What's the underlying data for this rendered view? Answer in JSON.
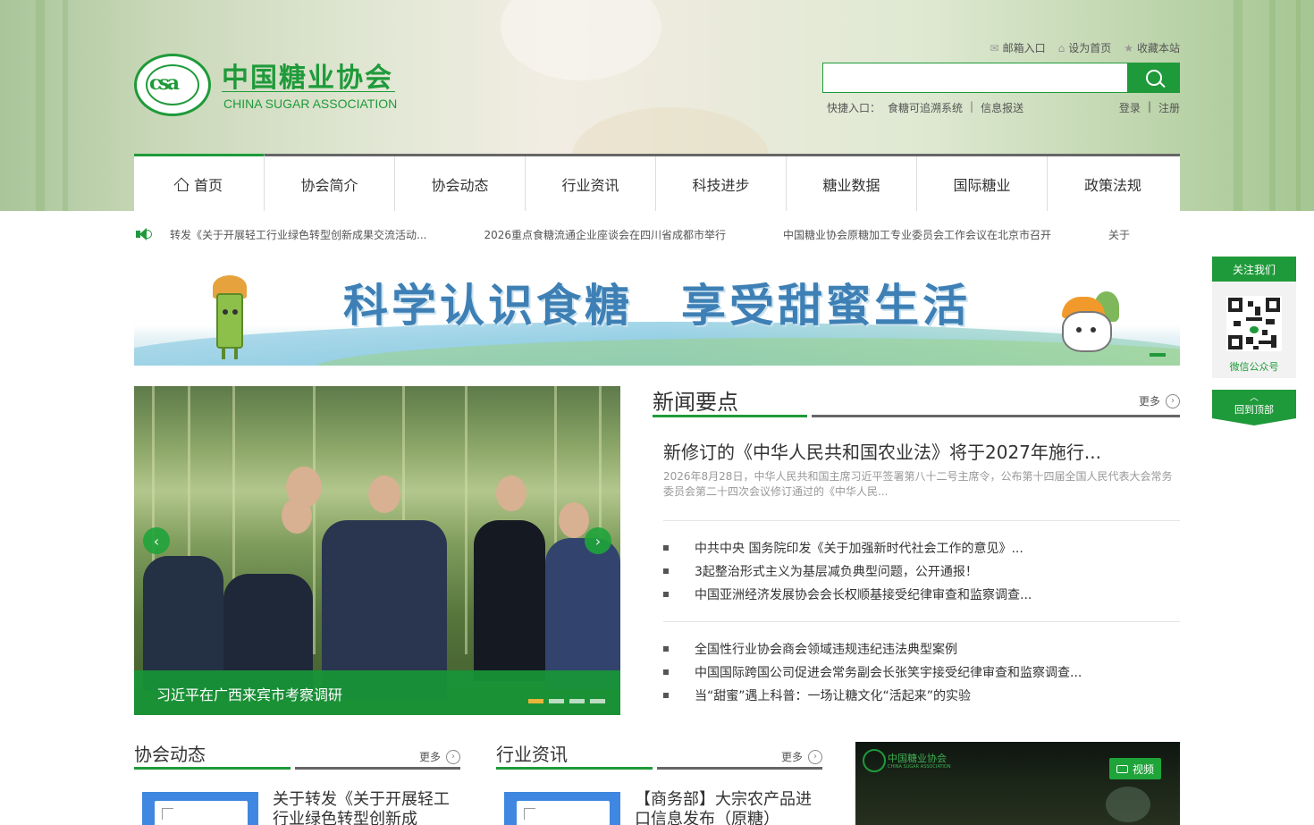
{
  "header": {
    "logo_cn": "中国糖业协会",
    "logo_en": "CHINA SUGAR ASSOCIATION",
    "logo_seal_text": "CHINA SUGAR ASSOCIATION",
    "top_links": [
      "邮箱入口",
      "设为首页",
      "收藏本站"
    ],
    "search": {
      "placeholder": "",
      "value": ""
    },
    "quick_label": "快捷入口：",
    "quick_links": [
      "食糖可追溯系统",
      "|",
      "信息报送"
    ],
    "login": "登录",
    "login_sep": "|",
    "register": "注册"
  },
  "nav": {
    "items": [
      "首页",
      "协会简介",
      "协会动态",
      "行业资讯",
      "科技进步",
      "糖业数据",
      "国际糖业",
      "政策法规"
    ],
    "active": "首页"
  },
  "ticker": {
    "items": [
      "转发《关于开展轻工行业绿色转型创新成果交流活动...",
      "2026重点食糖流通企业座谈会在四川省成都市举行",
      "中国糖业协会原糖加工专业委员会工作会议在北京市召开",
      "关于"
    ]
  },
  "banner": {
    "slogan": "科学认识食糖　享受甜蜜生活"
  },
  "slideshow": {
    "caption": "习近平在广西来宾市考察调研",
    "prev": "‹",
    "next": "›",
    "dot_count": 4,
    "active_dot": 0
  },
  "news": {
    "title": "新闻要点",
    "more": "更多",
    "feature_title": "新修订的《中华人民共和国农业法》将于2027年施行...",
    "feature_desc": "2026年8月28日，中华人民共和国主席习近平签署第八十二号主席令，公布第十四届全国人民代表大会常务委员会第二十四次会议修订通过的《中华人民...",
    "group1": [
      "中共中央 国务院印发《关于加强新时代社会工作的意见》...",
      "3起整治形式主义为基层减负典型问题，公开通报！",
      "中国亚洲经济发展协会会长权顺基接受纪律审查和监察调查..."
    ],
    "group2": [
      "全国性行业协会商会领域违规违纪违法典型案例",
      "中国国际跨国公司促进会常务副会长张笑宇接受纪律审查和监察调查...",
      "当“甜蜜”遇上科普：一场让糖文化“活起来”的实验"
    ]
  },
  "association_news": {
    "title": "协会动态",
    "more": "更多",
    "item_title_line1": "关于转发《关于开展轻工",
    "item_title_line2": "行业绿色转型创新成"
  },
  "industry_news": {
    "title": "行业资讯",
    "more": "更多",
    "item_title_line1": "【商务部】大宗农产品进",
    "item_title_line2": "口信息发布（原糖）"
  },
  "video": {
    "badge": "视频",
    "logo_cn": "中国糖业协会",
    "logo_en": "CHINA SUGAR ASSOCIATION"
  },
  "side": {
    "follow": "关注我们",
    "wechat": "微信公众号",
    "back_top": "回到顶部",
    "back_top_icon": "︿"
  },
  "colors": {
    "brand_green": "#1f9a3a",
    "nav_border": "#666666"
  }
}
